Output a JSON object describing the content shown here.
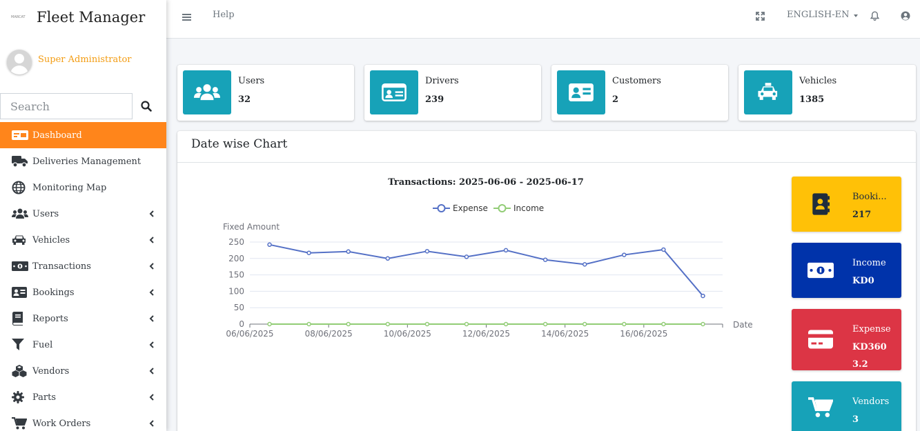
{
  "brand": {
    "title": "Fleet Manager",
    "logo_text": "MARCAT"
  },
  "user": {
    "name": "Super Administrator"
  },
  "search": {
    "placeholder": "Search"
  },
  "sidebar": {
    "items": [
      {
        "label": "Dashboard",
        "icon": "dashboard-icon"
      },
      {
        "label": "Deliveries Management",
        "icon": "truck-icon"
      },
      {
        "label": "Monitoring Map",
        "icon": "globe-icon"
      },
      {
        "label": "Users",
        "icon": "users-icon"
      },
      {
        "label": "Vehicles",
        "icon": "car-icon"
      },
      {
        "label": "Transactions",
        "icon": "money-icon"
      },
      {
        "label": "Bookings",
        "icon": "id-card-icon"
      },
      {
        "label": "Reports",
        "icon": "book-icon"
      },
      {
        "label": "Fuel",
        "icon": "filter-icon"
      },
      {
        "label": "Vendors",
        "icon": "cubes-icon"
      },
      {
        "label": "Parts",
        "icon": "gear-icon"
      },
      {
        "label": "Work Orders",
        "icon": "cart-icon"
      }
    ]
  },
  "topbar": {
    "help": "Help",
    "language": "ENGLISH-EN"
  },
  "info_boxes": [
    {
      "label": "Users",
      "value": "32"
    },
    {
      "label": "Drivers",
      "value": "239"
    },
    {
      "label": "Customers",
      "value": "2"
    },
    {
      "label": "Vehicles",
      "value": "1385"
    }
  ],
  "card": {
    "title": "Date wise Chart"
  },
  "stats": [
    {
      "label": "Booki...",
      "value": "217"
    },
    {
      "label": "Income",
      "value": "KD0"
    },
    {
      "label": "Expense",
      "value": "KD3603.2"
    },
    {
      "label": "Vendors",
      "value": "3"
    }
  ],
  "colors": {
    "accent": "#ff851b",
    "teal": "#17a2b8",
    "expense_line": "#5470c6",
    "income_line": "#91cc75"
  },
  "chart_data": {
    "type": "line",
    "title": "Transactions: 2025-06-06 - 2025-06-17",
    "ylabel": "Fixed Amount",
    "xlabel": "Date",
    "ylim": [
      0,
      250
    ],
    "yticks": [
      0,
      50,
      100,
      150,
      200,
      250
    ],
    "x": [
      "2025-06-06",
      "2025-06-07",
      "2025-06-08",
      "2025-06-09",
      "2025-06-10",
      "2025-06-11",
      "2025-06-12",
      "2025-06-13",
      "2025-06-14",
      "2025-06-15",
      "2025-06-16",
      "2025-06-17"
    ],
    "xtick_labels": [
      "06/06/2025",
      "08/06/2025",
      "10/06/2025",
      "12/06/2025",
      "14/06/2025",
      "16/06/2025"
    ],
    "legend": "top-center",
    "grid": true,
    "series": [
      {
        "name": "Expense",
        "color": "#5470c6",
        "values": [
          242,
          217,
          221,
          200,
          222,
          205,
          225,
          196,
          182,
          211,
          227,
          86
        ]
      },
      {
        "name": "Income",
        "color": "#91cc75",
        "values": [
          0,
          0,
          0,
          0,
          0,
          0,
          0,
          0,
          0,
          0,
          0,
          0
        ]
      }
    ]
  }
}
